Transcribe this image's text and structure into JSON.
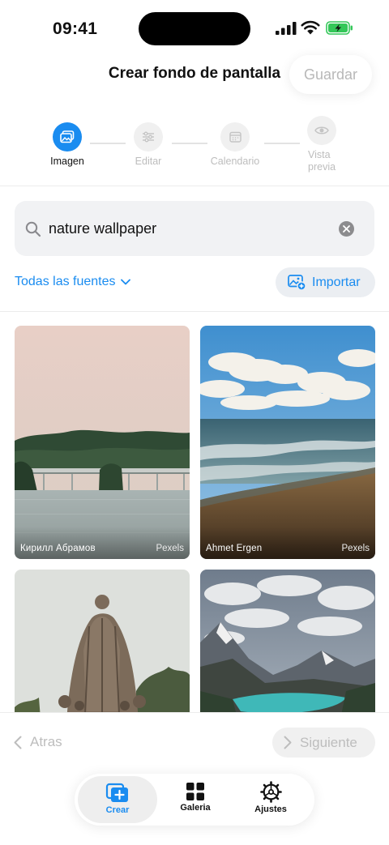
{
  "status_bar": {
    "time": "09:41"
  },
  "header": {
    "title": "Crear fondo de pantalla",
    "save_label": "Guardar"
  },
  "stepper": {
    "steps": [
      {
        "label": "Imagen",
        "icon": "image-icon",
        "active": true
      },
      {
        "label": "Editar",
        "icon": "sliders-icon",
        "active": false
      },
      {
        "label": "Calendario",
        "icon": "calendar-icon",
        "active": false
      },
      {
        "label": "Vista previa",
        "icon": "eye-icon",
        "active": false
      }
    ]
  },
  "search": {
    "value": "nature wallpaper"
  },
  "filters": {
    "source_label": "Todas las fuentes",
    "import_label": "Importar"
  },
  "results": [
    {
      "author": "Кирилл Абрамов",
      "source": "Pexels"
    },
    {
      "author": "Ahmet Ergen",
      "source": "Pexels"
    },
    {
      "author": "",
      "source": ""
    },
    {
      "author": "",
      "source": ""
    }
  ],
  "navigation": {
    "back_label": "Atras",
    "next_label": "Siguiente"
  },
  "tabbar": {
    "tabs": [
      {
        "label": "Crear",
        "icon": "create-plus-icon",
        "active": true
      },
      {
        "label": "Galeria",
        "icon": "grid-icon",
        "active": false
      },
      {
        "label": "Ajustes",
        "icon": "gear-icon",
        "active": false
      }
    ]
  },
  "colors": {
    "accent": "#1a8cf0",
    "disabled_text": "#bdbdbd"
  }
}
